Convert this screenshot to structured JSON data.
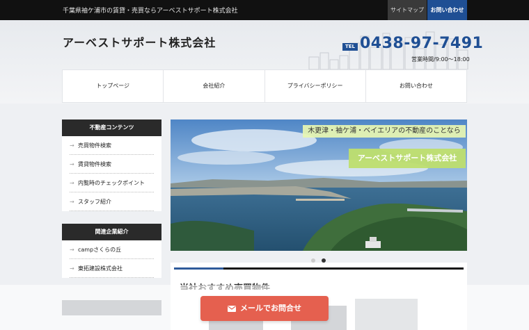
{
  "topbar": {
    "tagline": "千葉県袖ケ浦市の賃貸・売買ならアーベストサポート株式会社",
    "sitemap": "サイトマップ",
    "contact": "お問い合わせ"
  },
  "header": {
    "company": "アーベストサポート株式会社",
    "tel_badge": "TEL",
    "tel": "0438-97-7491",
    "hours": "営業時間/9:00〜18:00"
  },
  "nav": [
    "トップページ",
    "会社紹介",
    "プライバシーポリシー",
    "お問い合わせ"
  ],
  "sidebar": {
    "section1_title": "不動産コンテンツ",
    "section1_items": [
      "売買物件検索",
      "賃貸物件検索",
      "内覧時のチェックポイント",
      "スタッフ紹介"
    ],
    "section2_title": "関連企業紹介",
    "section2_items": [
      "campさくらの丘",
      "東拓建設株式会社"
    ]
  },
  "banner": {
    "caption1": "木更津・袖ケ浦・ベイエリアの不動産のことなら",
    "caption2": "アーベストサポート株式会社",
    "slide_count": 2,
    "active_slide": 2,
    "progress": 0.17
  },
  "section_title": "当社おすすめ売買物件",
  "cta": {
    "mail": "メールでお問合せ"
  },
  "colors": {
    "brand_blue": "#1f4f94",
    "cta_red": "#e5604f",
    "banner_green": "#bede6e"
  }
}
